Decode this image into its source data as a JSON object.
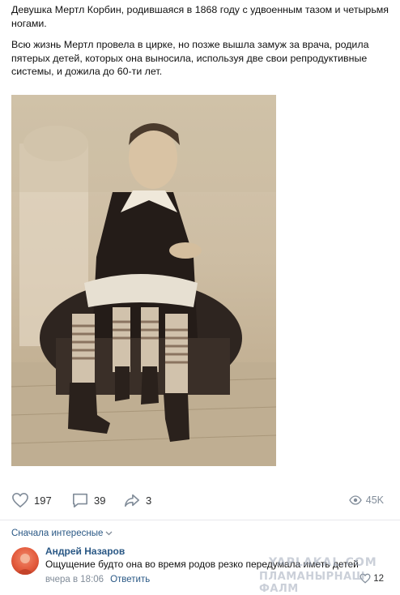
{
  "post": {
    "paragraph_1": "Девушка Мертл Корбин, родившаяся в 1868 году с удвоенным тазом и четырьмя ногами.",
    "paragraph_2": "Всю жизнь Мертл провела в цирке, но позже вышла замуж за врача, родила пятерых детей, которых она выносила, используя две свои репродуктивные системы, и дожила до 60-ти лет."
  },
  "actions": {
    "likes": "197",
    "comments": "39",
    "shares": "3",
    "views": "45K"
  },
  "comments_section": {
    "sort_label": "Сначала интересные",
    "comment": {
      "author": "Андрей Назаров",
      "text": "Ощущение будто она во время родов резко передумала иметь детей",
      "time": "вчера в 18:06",
      "reply_label": "Ответить",
      "likes": "12"
    }
  },
  "watermark": {
    "line_1": "YAPLAKAL.COM",
    "line_2": "ПЛАМАНЫРНАШ ФАЛМ"
  },
  "colors": {
    "link": "#2a5885",
    "muted": "#818c99",
    "photo_sepia": "#cdbda3"
  },
  "icons": [
    "heart-icon",
    "comment-icon",
    "share-icon",
    "eye-icon",
    "chevron-down-icon"
  ]
}
